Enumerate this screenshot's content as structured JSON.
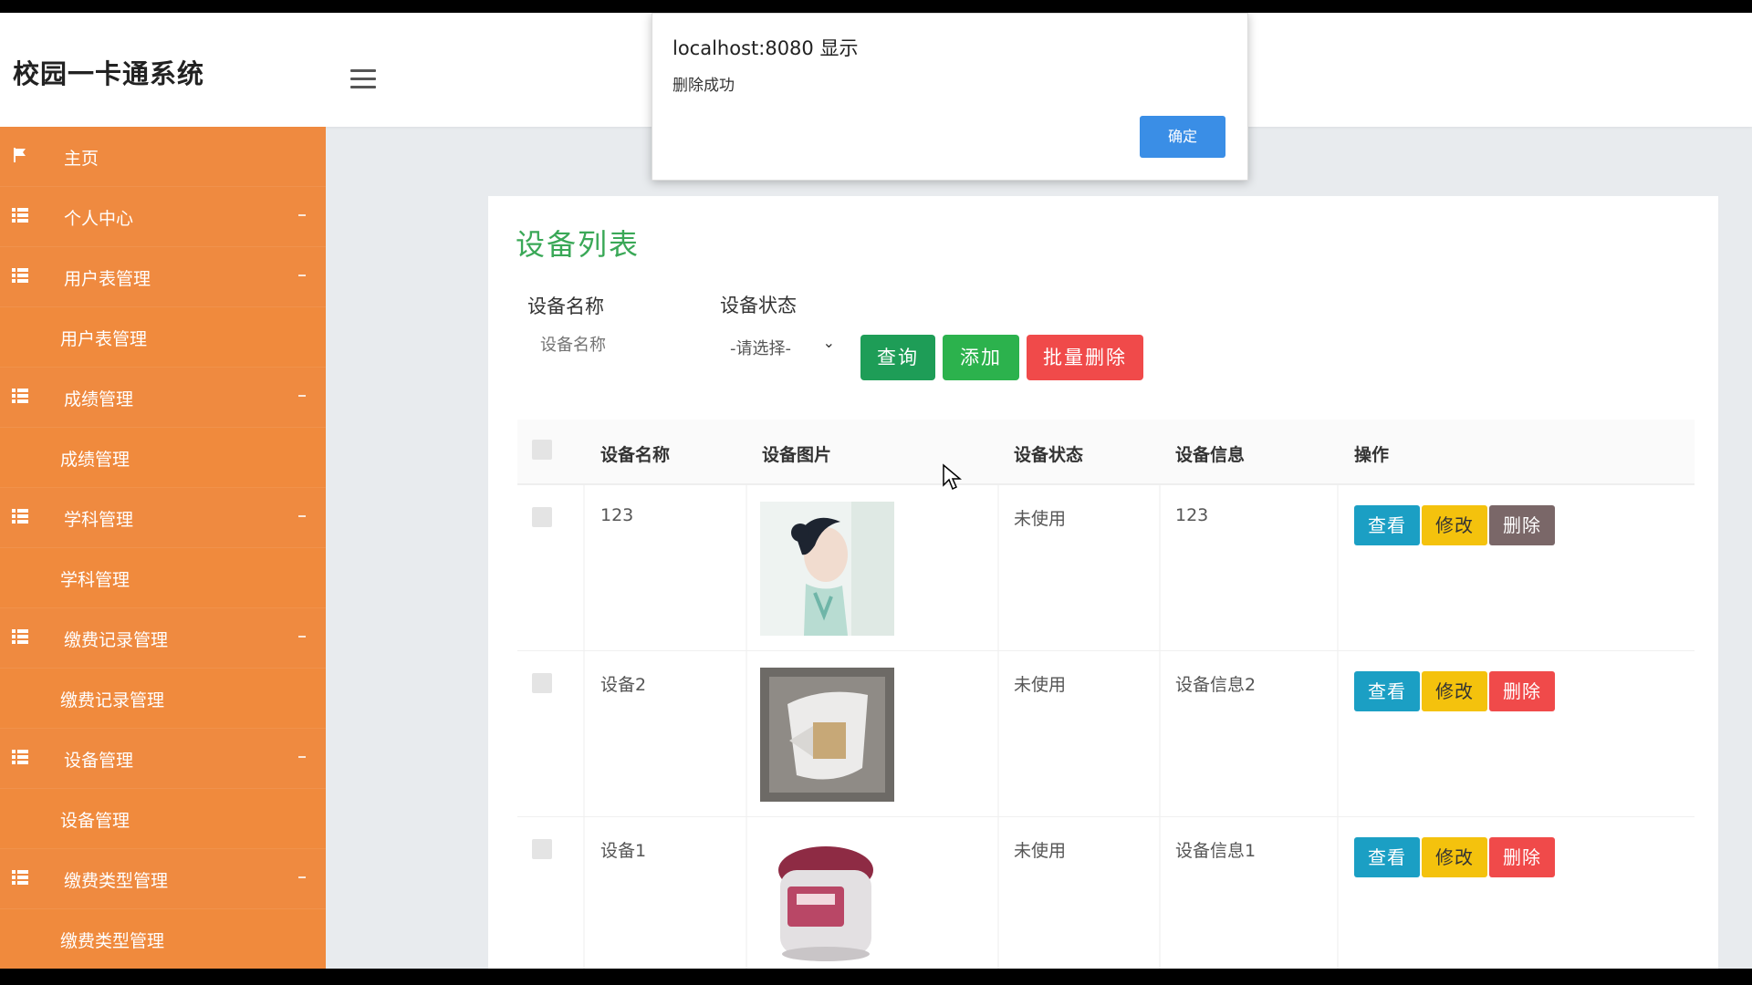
{
  "header": {
    "brand": "校园一卡通系统"
  },
  "sidebar": {
    "items": [
      {
        "label": "主页",
        "type": "parent",
        "icon": "flag-icon"
      },
      {
        "label": "个人中心",
        "type": "parent",
        "icon": "grid-icon"
      },
      {
        "label": "用户表管理",
        "type": "parent",
        "icon": "grid-icon"
      },
      {
        "label": "用户表管理",
        "type": "child"
      },
      {
        "label": "成绩管理",
        "type": "parent",
        "icon": "grid-icon"
      },
      {
        "label": "成绩管理",
        "type": "child"
      },
      {
        "label": "学科管理",
        "type": "parent",
        "icon": "grid-icon"
      },
      {
        "label": "学科管理",
        "type": "child"
      },
      {
        "label": "缴费记录管理",
        "type": "parent",
        "icon": "grid-icon"
      },
      {
        "label": "缴费记录管理",
        "type": "child"
      },
      {
        "label": "设备管理",
        "type": "parent",
        "icon": "grid-icon"
      },
      {
        "label": "设备管理",
        "type": "child"
      },
      {
        "label": "缴费类型管理",
        "type": "parent",
        "icon": "grid-icon"
      },
      {
        "label": "缴费类型管理",
        "type": "child"
      }
    ]
  },
  "main": {
    "title": "设备列表",
    "search": {
      "name_label": "设备名称",
      "name_placeholder": "设备名称",
      "status_label": "设备状态",
      "status_selected": "-请选择-"
    },
    "buttons": {
      "query": "查询",
      "add": "添加",
      "batch_delete": "批量删除"
    },
    "table": {
      "headers": [
        "设备名称",
        "设备图片",
        "设备状态",
        "设备信息",
        "操作"
      ],
      "rows": [
        {
          "name": "123",
          "status": "未使用",
          "info": "123"
        },
        {
          "name": "设备2",
          "status": "未使用",
          "info": "设备信息2"
        },
        {
          "name": "设备1",
          "status": "未使用",
          "info": "设备信息1"
        }
      ],
      "actions": {
        "view": "查看",
        "edit": "修改",
        "delete": "删除"
      }
    }
  },
  "dialog": {
    "title": "localhost:8080 显示",
    "message": "删除成功",
    "ok": "确定"
  },
  "colors": {
    "sidebar": "#f0883e",
    "title_green": "#3aa857",
    "query": "#1e9d57",
    "add": "#2cb24d",
    "batch_delete": "#f04a4a",
    "view": "#1b9fc4",
    "edit": "#f4c20d",
    "delete": "#f04a4a",
    "dialog_ok": "#3a8ee6"
  }
}
